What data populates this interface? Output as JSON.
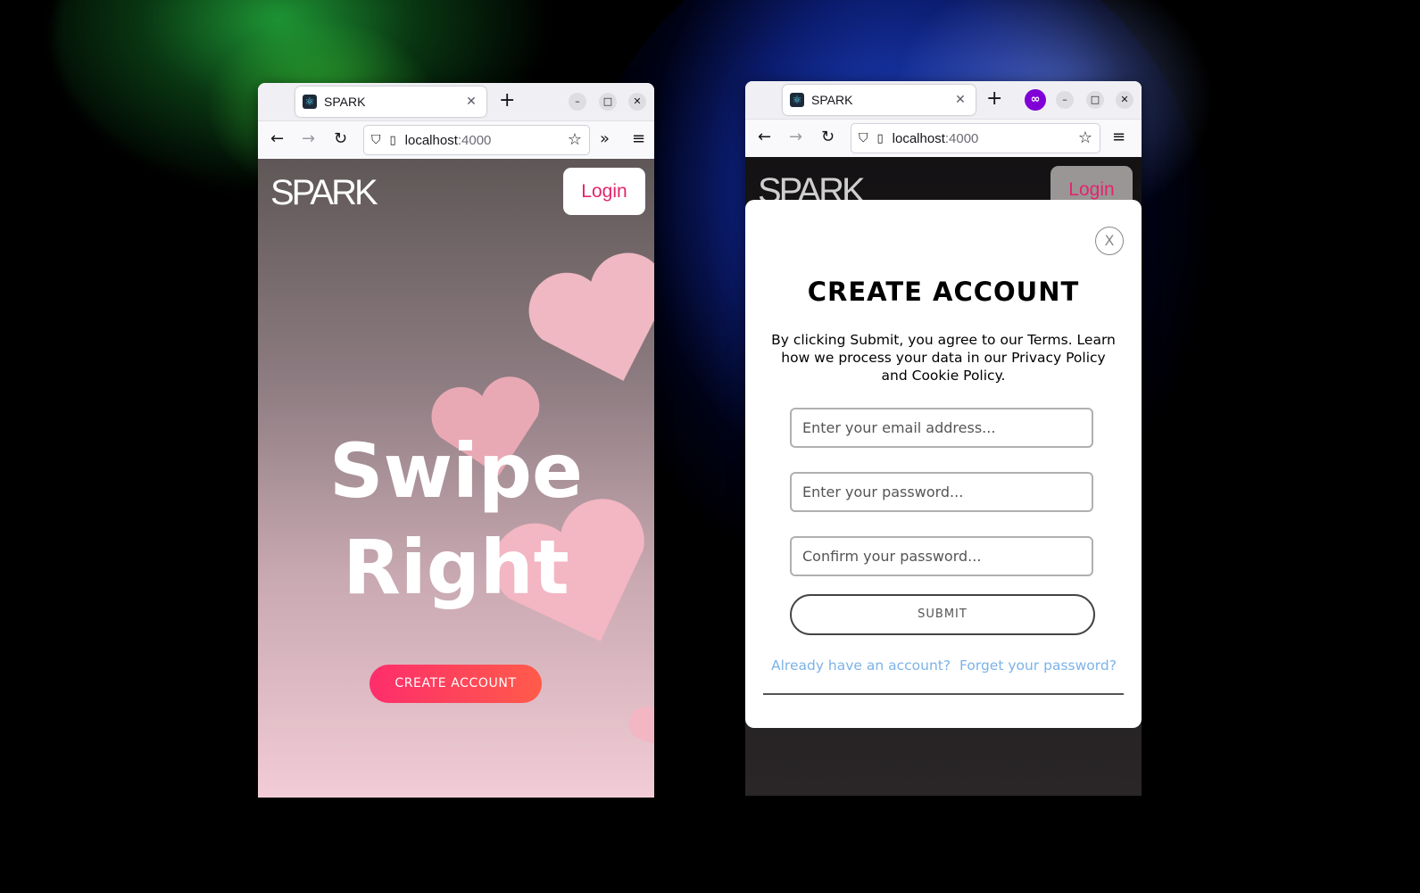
{
  "left_window": {
    "tab": {
      "title": "SPARK"
    },
    "url": {
      "host": "localhost",
      "port": ":4000"
    },
    "page": {
      "logo": "SPARK",
      "login_label": "Login",
      "hero_line1": "Swipe",
      "hero_line2": "Right",
      "cta_label": "CREATE ACCOUNT"
    }
  },
  "right_window": {
    "tab": {
      "title": "SPARK"
    },
    "url": {
      "host": "localhost",
      "port": ":4000"
    },
    "page": {
      "logo": "SPARK",
      "login_label": "Login"
    },
    "modal": {
      "close_label": "X",
      "title": "CREATE ACCOUNT",
      "terms_text": "By clicking Submit, you agree to our Terms. Learn how we process your data in our Privacy Policy and Cookie Policy.",
      "email_placeholder": "Enter your email address...",
      "password_placeholder": "Enter your password...",
      "confirm_placeholder": "Confirm your password...",
      "submit_label": "SUBMIT",
      "have_account_link": "Already have an account?",
      "forgot_link": "Forget your password?"
    }
  },
  "icons": {
    "favicon": "react-atom-icon",
    "tab_close": "close-icon",
    "new_tab": "plus-icon",
    "minimize": "minimize-icon",
    "maximize": "maximize-icon",
    "close_window": "close-icon",
    "private_browsing": "private-mask-icon",
    "back": "arrow-left-icon",
    "forward": "arrow-right-icon",
    "reload": "reload-icon",
    "shield": "shield-icon",
    "page": "page-icon",
    "bookmark": "star-icon",
    "overflow": "chevron-double-right-icon",
    "menu": "hamburger-menu-icon"
  },
  "colors": {
    "brand_pink": "#e2256d",
    "cta_gradient_start": "#fe2d6b",
    "cta_gradient_end": "#ff5b4a",
    "link_blue": "#7cb3e8"
  }
}
